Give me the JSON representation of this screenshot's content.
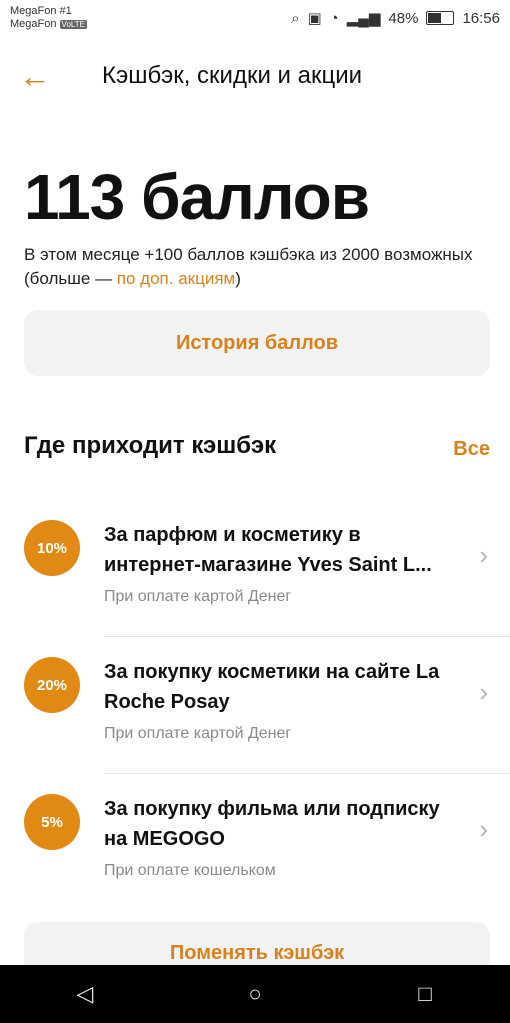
{
  "status_bar": {
    "carrier_1": "MegaFon #1",
    "carrier_2": "MegaFon",
    "volte": "VoLTE",
    "battery": "48%",
    "time": "16:56"
  },
  "header": {
    "back_icon": "arrow-left-icon",
    "title": "Кэшбэк, скидки и акции"
  },
  "summary": {
    "points": "113 баллов",
    "desc_prefix": "В этом месяце +100 баллов кэшбэка из 2000 возможных (больше — ",
    "desc_link": "по доп. акциям",
    "desc_suffix": ")"
  },
  "history_button": "История баллов",
  "section": {
    "title": "Где приходит кэшбэк",
    "all": "Все"
  },
  "cashback_items": [
    {
      "badge": "10%",
      "title": "За парфюм и косметику в интернет-магазине Yves Saint L...",
      "sub": "При оплате картой Денег"
    },
    {
      "badge": "20%",
      "title": "За покупку косметики на сайте La Roche Posay",
      "sub": "При оплате картой Денег"
    },
    {
      "badge": "5%",
      "title": "За покупку фильма или подписку на MEGOGO",
      "sub": "При оплате кошельком"
    }
  ],
  "change_button": "Поменять кэшбэк",
  "colors": {
    "accent": "#d9821b",
    "badge": "#e08a15"
  },
  "nav": {
    "back": "nav-back-icon",
    "home": "nav-home-icon",
    "recent": "nav-recent-icon"
  }
}
